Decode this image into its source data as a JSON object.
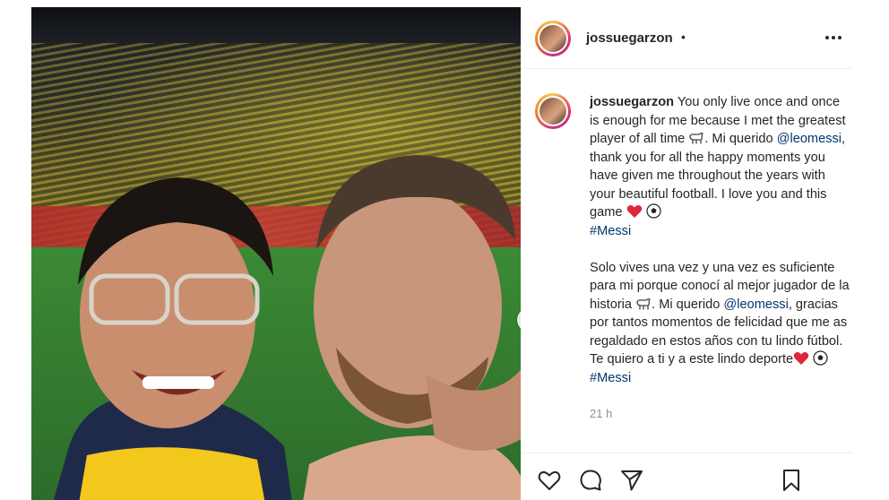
{
  "post": {
    "username": "jossuegarzon",
    "header_separator": "•",
    "caption": {
      "username": "jossuegarzon",
      "en_before_goat": "You only live once and once is enough for me because I met the greatest player of all time",
      "en_between": ". Mi querido",
      "mention": "@leomessi",
      "en_after_mention": ", thank you for all the happy moments you have given me throughout the years with your beautiful football. I love you and this game",
      "hashtag": "#Messi",
      "es_before_goat": "Solo vives una vez y una vez es suficiente para mi porque conocí al mejor jugador de la historia",
      "es_between": ". Mi querido",
      "es_mention": "@leomessi",
      "es_after_mention": ", gracias por tantos momentos de felicidad que me as regaldado en estos años con tu lindo fútbol. Te quiero a ti y a este lindo deporte",
      "es_hashtag": "#Messi"
    },
    "time_ago": "21 h",
    "icons": {
      "more": "more-options-icon",
      "like": "heart-icon",
      "comment": "comment-icon",
      "share": "paper-plane-icon",
      "save": "bookmark-icon",
      "next": "chevron-right-icon",
      "goat": "goat-emoji-icon",
      "heart": "red-heart-emoji-icon",
      "ball": "soccer-ball-emoji-icon"
    },
    "colors": {
      "link": "#00376b",
      "text": "#262626",
      "muted": "#8e8e8e",
      "border": "#efefef",
      "heart_emoji": "#e0263c"
    }
  }
}
